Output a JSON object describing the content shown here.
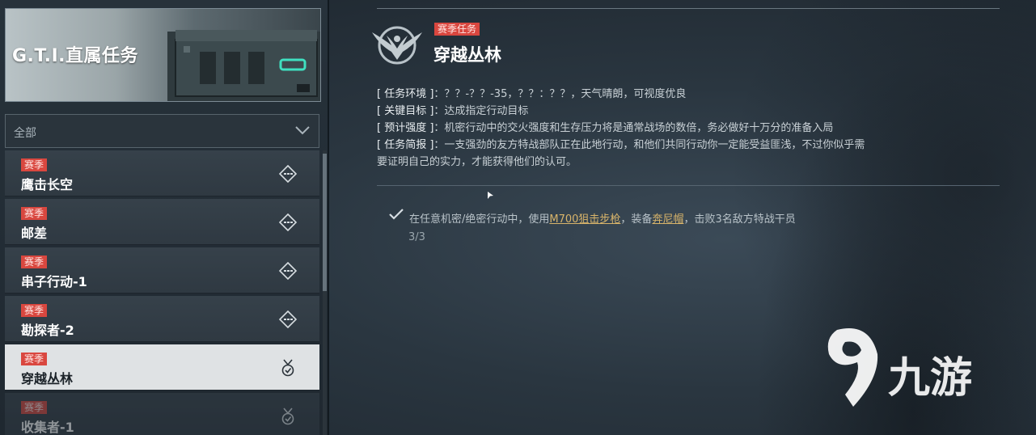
{
  "left": {
    "banner_title": "G.T.I.直属任务",
    "filter": {
      "label": "全部"
    },
    "items": [
      {
        "badge": "赛季",
        "title": "鹰击长空",
        "status": "incomplete"
      },
      {
        "badge": "赛季",
        "title": "邮差",
        "status": "incomplete"
      },
      {
        "badge": "赛季",
        "title": "串子行动-1",
        "status": "incomplete"
      },
      {
        "badge": "赛季",
        "title": "勘探者-2",
        "status": "incomplete"
      },
      {
        "badge": "赛季",
        "title": "穿越丛林",
        "status": "completed",
        "selected": true
      },
      {
        "badge": "赛季",
        "title": "收集者-1",
        "status": "completed"
      }
    ]
  },
  "mission": {
    "type_badge": "赛季任务",
    "title": "穿越丛林",
    "environment_label": "[ 任务环境 ]",
    "environment_value": "：？？-？？-35，？？：？？，天气晴朗，可视度优良",
    "objective_label": "[ 关键目标 ]",
    "objective_value": "：达成指定行动目标",
    "intensity_label": "[ 预计强度 ]",
    "intensity_value": "：机密行动中的交火强度和生存压力将是通常战场的数倍，务必做好十万分的准备入局",
    "brief_label": "[ 任务简报 ]",
    "brief_value": "：一支强劲的友方特战部队正在此地行动，和他们共同行动你一定能受益匪浅，不过你似乎需要证明自己的实力，才能获得他们的认可。"
  },
  "task": {
    "prefix": "在任意机密/绝密行动中，使用",
    "weapon": "M700狙击步枪",
    "middle": "，装备",
    "gear": "奔尼帽",
    "suffix": "，击败3名敌方特战干员",
    "progress": "3/3"
  },
  "watermark": {
    "text": "九游"
  }
}
